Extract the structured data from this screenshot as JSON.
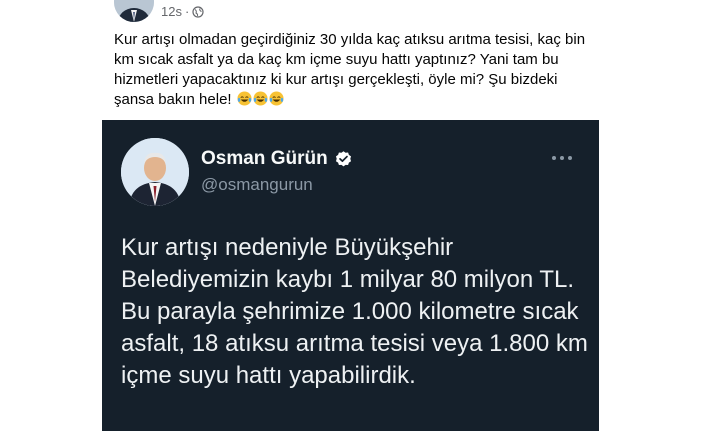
{
  "fb_post": {
    "timestamp": "12s",
    "separator": "·",
    "text": "Kur artışı olmadan geçirdiğiniz 30 yılda kaç atıksu arıtma tesisi, kaç bin km sıcak asfalt ya da kaç km içme suyu hattı yaptınız? Yani tam bu hizmetleri yapacaktınız ki kur artışı gerçekleşti, öyle mi? Şu bizdeki şansa bakın hele!",
    "emojis": [
      "laughing-tears",
      "laughing-tears",
      "laughing-tears"
    ]
  },
  "tweet": {
    "name": "Osman Gürün",
    "handle": "@osmangurun",
    "text": "Kur artışı nedeniyle Büyükşehir Belediyemizin kaybı 1 milyar 80 milyon TL. Bu parayla şehrimize 1.000 kilometre sıcak asfalt, 18 atıksu arıtma tesisi veya 1.800 km içme suyu hattı yapabilirdik.",
    "verified": true,
    "background": "#15202b",
    "verified_color": "#ffffff"
  }
}
